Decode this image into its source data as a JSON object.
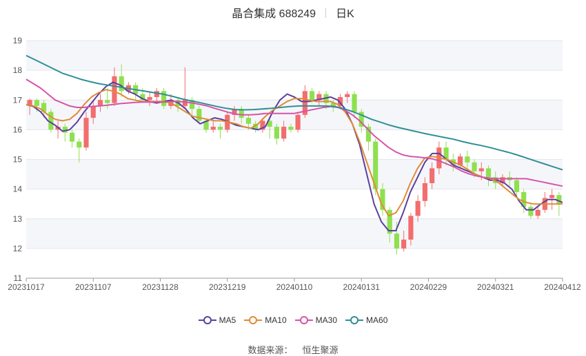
{
  "header": {
    "stock": "晶合集成 688249",
    "period": "日K"
  },
  "source": {
    "label": "数据来源：",
    "value": "恒生聚源"
  },
  "colors": {
    "up": "#f26d6d",
    "down": "#8ee04f",
    "grid": "#e3e6ee",
    "band": "#f5f6fa",
    "MA5": "#5b3fa0",
    "MA10": "#e08b35",
    "MA30": "#d653a8",
    "MA60": "#2f8f94"
  },
  "chart_data": {
    "type": "candlestick",
    "title": "晶合集成 688249 日K",
    "ylim": [
      11,
      19
    ],
    "yticks": [
      11,
      12,
      13,
      14,
      15,
      16,
      17,
      18,
      19
    ],
    "grid": true,
    "legend_position": "bottom",
    "xtick_labels": [
      "20231017",
      "20231107",
      "20231128",
      "20231219",
      "20240110",
      "20240131",
      "20240229",
      "20240321",
      "20240412"
    ],
    "series": [
      {
        "name": "MA5",
        "values": [
          16.85,
          16.78,
          16.6,
          16.3,
          16.15,
          15.95,
          16,
          16.25,
          16.6,
          16.9,
          17.2,
          17.45,
          17.6,
          17.5,
          17.3,
          17.2,
          17.05,
          16.95,
          16.9,
          16.95,
          17,
          16.9,
          16.7,
          16.4,
          16.2,
          16.3,
          16.4,
          16.35,
          16.25,
          16.15,
          16.1,
          16.05,
          16,
          16.1,
          16.6,
          17,
          17.2,
          17.1,
          16.95,
          16.95,
          17,
          17.05,
          17.1,
          17,
          16.7,
          16.2,
          15.5,
          14.5,
          13.5,
          12.9,
          12.6,
          12.6,
          13.2,
          13.9,
          14.4,
          14.9,
          15.2,
          15.2,
          15,
          14.8,
          14.7,
          14.6,
          14.5,
          14.4,
          14.3,
          14.3,
          14.2,
          14,
          13.6,
          13.3,
          13.3,
          13.5,
          13.65,
          13.65,
          13.55
        ]
      },
      {
        "name": "MA10",
        "values": [
          16.85,
          16.8,
          16.7,
          16.5,
          16.35,
          16.3,
          16.35,
          16.55,
          16.85,
          17.1,
          17.25,
          17.35,
          17.3,
          17.2,
          17.05,
          17,
          16.95,
          16.95,
          16.95,
          16.95,
          16.9,
          16.75,
          16.6,
          16.45,
          16.4,
          16.35,
          16.3,
          16.3,
          16.25,
          16.2,
          16.1,
          16.05,
          16.2,
          16.45,
          16.65,
          16.8,
          16.95,
          17.05,
          17.05,
          17,
          16.95,
          16.95,
          16.95,
          16.85,
          16.6,
          16.2,
          15.6,
          14.9,
          14.2,
          13.5,
          13.1,
          13.2,
          13.6,
          14.2,
          14.7,
          15.05,
          15.1,
          15.05,
          15,
          14.9,
          14.8,
          14.65,
          14.5,
          14.4,
          14.35,
          14.25,
          14.05,
          13.85,
          13.65,
          13.55,
          13.5,
          13.5,
          13.5,
          13.5,
          13.5
        ]
      },
      {
        "name": "MA30",
        "values": [
          17.7,
          17.55,
          17.4,
          17.2,
          17,
          16.9,
          16.8,
          16.75,
          16.75,
          16.78,
          16.8,
          16.82,
          16.85,
          16.88,
          16.9,
          16.92,
          16.93,
          16.93,
          16.93,
          16.93,
          16.95,
          16.95,
          16.93,
          16.9,
          16.85,
          16.8,
          16.72,
          16.65,
          16.58,
          16.52,
          16.5,
          16.5,
          16.52,
          16.55,
          16.55,
          16.55,
          16.55,
          16.55,
          16.6,
          16.65,
          16.7,
          16.75,
          16.78,
          16.75,
          16.65,
          16.5,
          16.3,
          16.05,
          15.8,
          15.6,
          15.4,
          15.25,
          15.15,
          15.1,
          15.08,
          15.05,
          15.02,
          14.95,
          14.85,
          14.75,
          14.62,
          14.52,
          14.45,
          14.4,
          14.37,
          14.35,
          14.35,
          14.35,
          14.35,
          14.35,
          14.3,
          14.25,
          14.2,
          14.15,
          14.1
        ]
      },
      {
        "name": "MA60",
        "values": [
          18.5,
          18.35,
          18.2,
          18.05,
          17.9,
          17.8,
          17.7,
          17.62,
          17.55,
          17.5,
          17.45,
          17.4,
          17.35,
          17.3,
          17.25,
          17.2,
          17.13,
          17.05,
          16.98,
          16.92,
          16.85,
          16.78,
          16.72,
          16.68,
          16.67,
          16.68,
          16.7,
          16.72,
          16.75,
          16.78,
          16.8,
          16.8,
          16.8,
          16.8,
          16.78,
          16.7,
          16.6,
          16.48,
          16.35,
          16.25,
          16.15,
          16.07,
          16,
          15.93,
          15.86,
          15.8,
          15.74,
          15.68,
          15.6,
          15.53,
          15.47,
          15.4,
          15.32,
          15.24,
          15.15,
          15.05,
          14.95,
          14.85,
          14.75,
          14.65
        ]
      }
    ],
    "candles": [
      {
        "o": 16.8,
        "c": 17.0,
        "h": 17.05,
        "l": 16.5
      },
      {
        "o": 17.0,
        "c": 16.8,
        "h": 17.05,
        "l": 16.6
      },
      {
        "o": 16.9,
        "c": 16.6,
        "h": 17.0,
        "l": 16.4
      },
      {
        "o": 16.6,
        "c": 16.0,
        "h": 16.7,
        "l": 15.9
      },
      {
        "o": 16.0,
        "c": 16.1,
        "h": 16.3,
        "l": 15.7
      },
      {
        "o": 16.1,
        "c": 15.9,
        "h": 16.2,
        "l": 15.6
      },
      {
        "o": 15.9,
        "c": 15.6,
        "h": 16.0,
        "l": 15.4
      },
      {
        "o": 15.6,
        "c": 15.4,
        "h": 15.7,
        "l": 14.9
      },
      {
        "o": 15.4,
        "c": 16.4,
        "h": 16.6,
        "l": 15.3
      },
      {
        "o": 16.4,
        "c": 16.8,
        "h": 17.0,
        "l": 16.2
      },
      {
        "o": 16.8,
        "c": 17.0,
        "h": 17.2,
        "l": 16.6
      },
      {
        "o": 17.0,
        "c": 16.9,
        "h": 17.4,
        "l": 16.7
      },
      {
        "o": 16.9,
        "c": 17.8,
        "h": 18.1,
        "l": 16.8
      },
      {
        "o": 17.8,
        "c": 17.3,
        "h": 18.2,
        "l": 17.1
      },
      {
        "o": 17.3,
        "c": 17.5,
        "h": 17.6,
        "l": 17.2
      },
      {
        "o": 17.5,
        "c": 17.2,
        "h": 17.6,
        "l": 17.0
      },
      {
        "o": 17.2,
        "c": 17.0,
        "h": 17.4,
        "l": 16.9
      },
      {
        "o": 17.0,
        "c": 17.1,
        "h": 17.3,
        "l": 16.8
      },
      {
        "o": 17.1,
        "c": 17.3,
        "h": 17.4,
        "l": 16.9
      },
      {
        "o": 17.3,
        "c": 16.8,
        "h": 17.4,
        "l": 16.7
      },
      {
        "o": 16.8,
        "c": 17.0,
        "h": 17.2,
        "l": 16.7
      },
      {
        "o": 17.0,
        "c": 16.8,
        "h": 17.1,
        "l": 16.6
      },
      {
        "o": 16.8,
        "c": 17.0,
        "h": 18.1,
        "l": 16.7
      },
      {
        "o": 17.0,
        "c": 16.7,
        "h": 17.1,
        "l": 16.5
      },
      {
        "o": 16.7,
        "c": 16.3,
        "h": 16.8,
        "l": 16.2
      },
      {
        "o": 16.3,
        "c": 16.0,
        "h": 16.4,
        "l": 15.9
      },
      {
        "o": 16.0,
        "c": 16.1,
        "h": 16.3,
        "l": 15.9
      },
      {
        "o": 16.1,
        "c": 16.0,
        "h": 16.2,
        "l": 15.7
      },
      {
        "o": 16.0,
        "c": 16.5,
        "h": 16.6,
        "l": 15.9
      },
      {
        "o": 16.5,
        "c": 16.7,
        "h": 16.8,
        "l": 16.3
      },
      {
        "o": 16.7,
        "c": 16.4,
        "h": 16.8,
        "l": 16.2
      },
      {
        "o": 16.4,
        "c": 16.2,
        "h": 16.5,
        "l": 16.0
      },
      {
        "o": 16.2,
        "c": 16.0,
        "h": 16.3,
        "l": 15.9
      },
      {
        "o": 16.0,
        "c": 16.3,
        "h": 16.4,
        "l": 15.9
      },
      {
        "o": 16.3,
        "c": 16.1,
        "h": 16.4,
        "l": 15.7
      },
      {
        "o": 16.1,
        "c": 15.7,
        "h": 16.2,
        "l": 15.5
      },
      {
        "o": 15.7,
        "c": 16.1,
        "h": 16.3,
        "l": 15.6
      },
      {
        "o": 16.1,
        "c": 16.0,
        "h": 16.2,
        "l": 15.9
      },
      {
        "o": 16.0,
        "c": 16.5,
        "h": 16.6,
        "l": 15.9
      },
      {
        "o": 16.5,
        "c": 17.3,
        "h": 17.5,
        "l": 16.4
      },
      {
        "o": 17.3,
        "c": 17.0,
        "h": 17.4,
        "l": 16.9
      },
      {
        "o": 17.0,
        "c": 17.2,
        "h": 17.3,
        "l": 16.8
      },
      {
        "o": 17.2,
        "c": 16.9,
        "h": 17.3,
        "l": 16.7
      },
      {
        "o": 16.9,
        "c": 16.8,
        "h": 17.0,
        "l": 16.6
      },
      {
        "o": 16.8,
        "c": 17.1,
        "h": 17.2,
        "l": 16.7
      },
      {
        "o": 17.1,
        "c": 17.2,
        "h": 17.3,
        "l": 16.9
      },
      {
        "o": 17.2,
        "c": 16.6,
        "h": 17.3,
        "l": 16.4
      },
      {
        "o": 16.6,
        "c": 16.1,
        "h": 16.7,
        "l": 15.9
      },
      {
        "o": 16.1,
        "c": 15.6,
        "h": 16.2,
        "l": 15.3
      },
      {
        "o": 15.6,
        "c": 14.0,
        "h": 15.7,
        "l": 13.8
      },
      {
        "o": 14.0,
        "c": 13.3,
        "h": 14.2,
        "l": 13.1
      },
      {
        "o": 13.3,
        "c": 12.5,
        "h": 13.4,
        "l": 12.2
      },
      {
        "o": 12.5,
        "c": 12.0,
        "h": 12.9,
        "l": 11.8
      },
      {
        "o": 12.0,
        "c": 12.3,
        "h": 12.6,
        "l": 11.9
      },
      {
        "o": 12.3,
        "c": 13.1,
        "h": 13.2,
        "l": 12.1
      },
      {
        "o": 13.1,
        "c": 13.6,
        "h": 13.8,
        "l": 12.9
      },
      {
        "o": 13.6,
        "c": 14.2,
        "h": 14.4,
        "l": 13.4
      },
      {
        "o": 14.2,
        "c": 14.7,
        "h": 14.9,
        "l": 14.0
      },
      {
        "o": 14.7,
        "c": 15.4,
        "h": 15.6,
        "l": 14.5
      },
      {
        "o": 15.4,
        "c": 15.0,
        "h": 15.6,
        "l": 14.8
      },
      {
        "o": 15.0,
        "c": 14.8,
        "h": 15.2,
        "l": 14.6
      },
      {
        "o": 14.8,
        "c": 15.1,
        "h": 15.2,
        "l": 14.7
      },
      {
        "o": 15.1,
        "c": 14.9,
        "h": 15.3,
        "l": 14.6
      },
      {
        "o": 14.9,
        "c": 14.6,
        "h": 15.0,
        "l": 14.4
      },
      {
        "o": 14.6,
        "c": 14.7,
        "h": 14.9,
        "l": 14.3
      },
      {
        "o": 14.7,
        "c": 14.4,
        "h": 14.8,
        "l": 14.1
      },
      {
        "o": 14.4,
        "c": 14.2,
        "h": 14.6,
        "l": 14.0
      },
      {
        "o": 14.2,
        "c": 14.4,
        "h": 14.5,
        "l": 14.1
      },
      {
        "o": 14.4,
        "c": 14.3,
        "h": 14.6,
        "l": 14.1
      },
      {
        "o": 14.3,
        "c": 13.9,
        "h": 14.4,
        "l": 13.7
      },
      {
        "o": 13.9,
        "c": 13.4,
        "h": 14.0,
        "l": 13.2
      },
      {
        "o": 13.4,
        "c": 13.1,
        "h": 13.5,
        "l": 13.0
      },
      {
        "o": 13.1,
        "c": 13.3,
        "h": 13.4,
        "l": 13.0
      },
      {
        "o": 13.3,
        "c": 13.7,
        "h": 13.9,
        "l": 13.2
      },
      {
        "o": 13.7,
        "c": 13.8,
        "h": 14.0,
        "l": 13.3
      },
      {
        "o": 13.8,
        "c": 13.5,
        "h": 13.9,
        "l": 13.1
      }
    ]
  }
}
